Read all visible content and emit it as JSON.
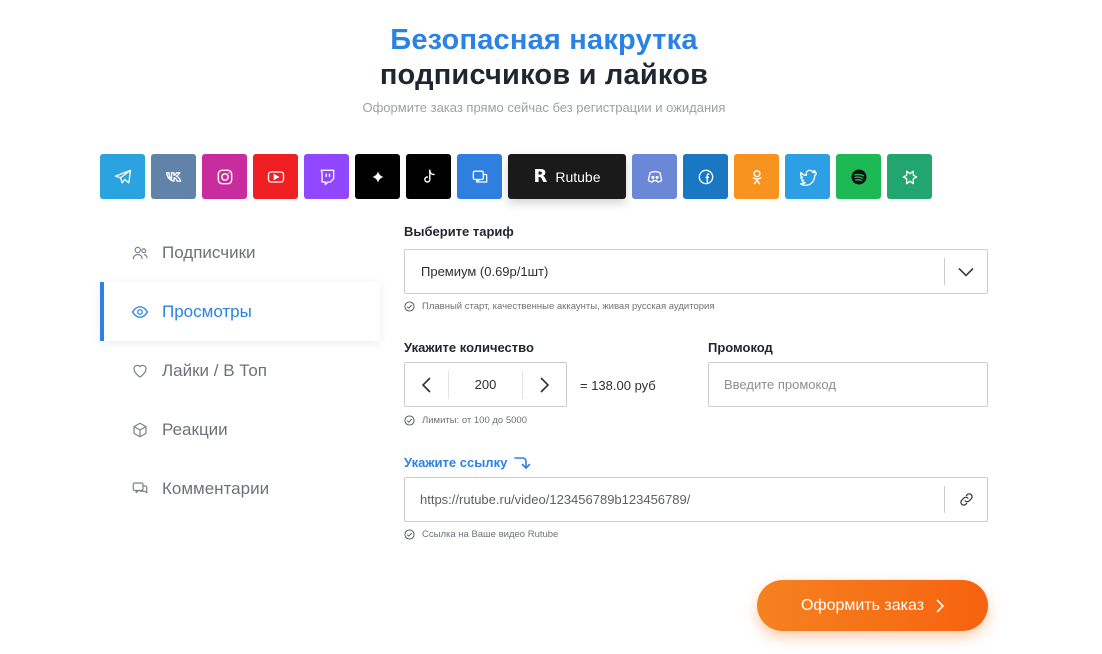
{
  "hero": {
    "title_line1": "Безопасная накрутка",
    "title_line2": "подписчиков и лайков",
    "subtitle": "Оформите заказ прямо сейчас без регистрации и ожидания"
  },
  "platforms": [
    {
      "name": "telegram",
      "icon": "telegram-icon",
      "color": "#2aa3e0"
    },
    {
      "name": "vk",
      "icon": "vk-icon",
      "color": "#6183a9"
    },
    {
      "name": "instagram",
      "icon": "instagram-icon",
      "color": "#c72d9c"
    },
    {
      "name": "youtube",
      "icon": "youtube-icon",
      "color": "#f01f24"
    },
    {
      "name": "twitch",
      "icon": "twitch-icon",
      "color": "#9146ff"
    },
    {
      "name": "threads",
      "icon": "sparkle-icon",
      "color": "#000000"
    },
    {
      "name": "tiktok",
      "icon": "tiktok-icon",
      "color": "#000000"
    },
    {
      "name": "chat",
      "icon": "chat-icon",
      "color": "#2f7fde"
    },
    {
      "name": "rutube",
      "label": "Rutube",
      "icon": "rutube-icon",
      "color": "#1a1a1a",
      "selected": true
    },
    {
      "name": "discord",
      "icon": "discord-icon",
      "color": "#6a87d8"
    },
    {
      "name": "facebook",
      "icon": "facebook-icon",
      "color": "#1a78c2"
    },
    {
      "name": "odnoklassniki",
      "icon": "ok-icon",
      "color": "#f7931e"
    },
    {
      "name": "twitter",
      "icon": "twitter-icon",
      "color": "#2d9fe4"
    },
    {
      "name": "spotify",
      "icon": "spotify-icon",
      "color": "#1db954"
    },
    {
      "name": "likee",
      "icon": "likee-icon",
      "color": "#20a66e"
    }
  ],
  "sidebar": {
    "items": [
      {
        "label": "Подписчики",
        "icon": "users-icon",
        "active": false
      },
      {
        "label": "Просмотры",
        "icon": "eye-icon",
        "active": true
      },
      {
        "label": "Лайки / В Топ",
        "icon": "heart-icon",
        "active": false
      },
      {
        "label": "Реакции",
        "icon": "cube-icon",
        "active": false
      },
      {
        "label": "Комментарии",
        "icon": "comments-icon",
        "active": false
      }
    ]
  },
  "form": {
    "tariff_label": "Выберите тариф",
    "tariff_value": "Премиум (0.69р/1шт)",
    "tariff_hint": "Плавный старт, качественные аккаунты, живая русская аудитория",
    "quantity_label": "Укажите количество",
    "quantity_value": "200",
    "total": "= 138.00 руб",
    "quantity_hint": "Лимиты: от 100 до 5000",
    "promo_label": "Промокод",
    "promo_placeholder": "Введите промокод",
    "link_label": "Укажите ссылку",
    "link_value": "https://rutube.ru/video/123456789b123456789/",
    "link_hint": "Ссылка на Ваше видео Rutube",
    "submit_label": "Оформить заказ"
  },
  "colors": {
    "accent": "#2a82e4",
    "submit": "#f7620f"
  }
}
